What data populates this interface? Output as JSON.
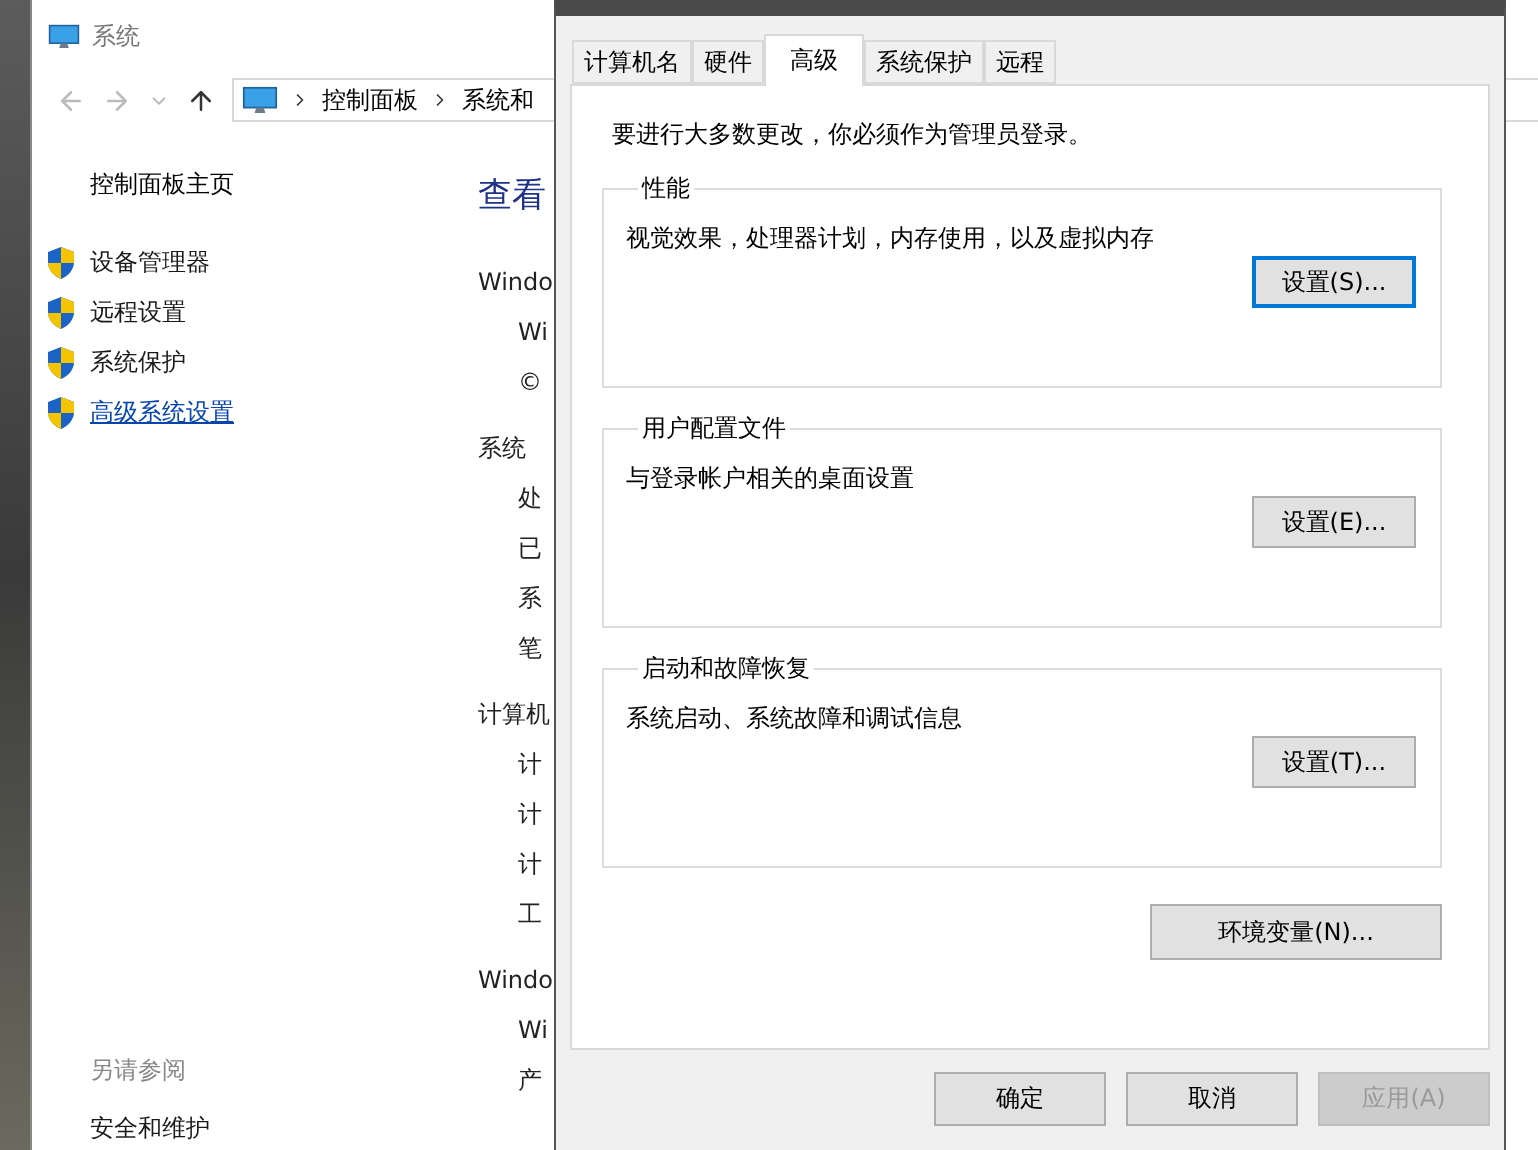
{
  "window": {
    "title": "系统",
    "breadcrumb": [
      "控制面板",
      "系统和"
    ],
    "sidebar": {
      "home": "控制面板主页",
      "links": [
        {
          "label": "设备管理器",
          "selected": false
        },
        {
          "label": "远程设置",
          "selected": false
        },
        {
          "label": "系统保护",
          "selected": false
        },
        {
          "label": "高级系统设置",
          "selected": true
        }
      ],
      "see_also": {
        "title": "另请参阅",
        "links": [
          "安全和维护"
        ]
      }
    },
    "content": {
      "heading": "查看",
      "lines": [
        {
          "kind": "section",
          "text": "Windo"
        },
        {
          "kind": "item",
          "text": "Wi"
        },
        {
          "kind": "item",
          "text": "©"
        },
        {
          "kind": "section",
          "text": "系统"
        },
        {
          "kind": "item",
          "text": "处"
        },
        {
          "kind": "item",
          "text": "已"
        },
        {
          "kind": "item",
          "text": "系"
        },
        {
          "kind": "item",
          "text": "笔"
        },
        {
          "kind": "section",
          "text": "计算机"
        },
        {
          "kind": "item",
          "text": "计"
        },
        {
          "kind": "item",
          "text": "计"
        },
        {
          "kind": "item",
          "text": "计"
        },
        {
          "kind": "item",
          "text": "工"
        },
        {
          "kind": "section",
          "text": "Windo"
        },
        {
          "kind": "item",
          "text": "Wi"
        },
        {
          "kind": "item",
          "text": "产"
        }
      ]
    }
  },
  "dialog": {
    "tabs": [
      {
        "label": "计算机名",
        "selected": false
      },
      {
        "label": "硬件",
        "selected": false
      },
      {
        "label": "高级",
        "selected": true
      },
      {
        "label": "系统保护",
        "selected": false
      },
      {
        "label": "远程",
        "selected": false
      }
    ],
    "notice": "要进行大多数更改，你必须作为管理员登录。",
    "groups": [
      {
        "title": "性能",
        "description": "视觉效果，处理器计划，内存使用，以及虚拟内存",
        "button": "设置(S)...",
        "focused": true
      },
      {
        "title": "用户配置文件",
        "description": "与登录帐户相关的桌面设置",
        "button": "设置(E)...",
        "focused": false
      },
      {
        "title": "启动和故障恢复",
        "description": "系统启动、系统故障和调试信息",
        "button": "设置(T)...",
        "focused": false
      }
    ],
    "env_button": "环境变量(N)...",
    "buttons": [
      {
        "label": "确定",
        "disabled": false
      },
      {
        "label": "取消",
        "disabled": false
      },
      {
        "label": "应用(A)",
        "disabled": true
      }
    ]
  }
}
